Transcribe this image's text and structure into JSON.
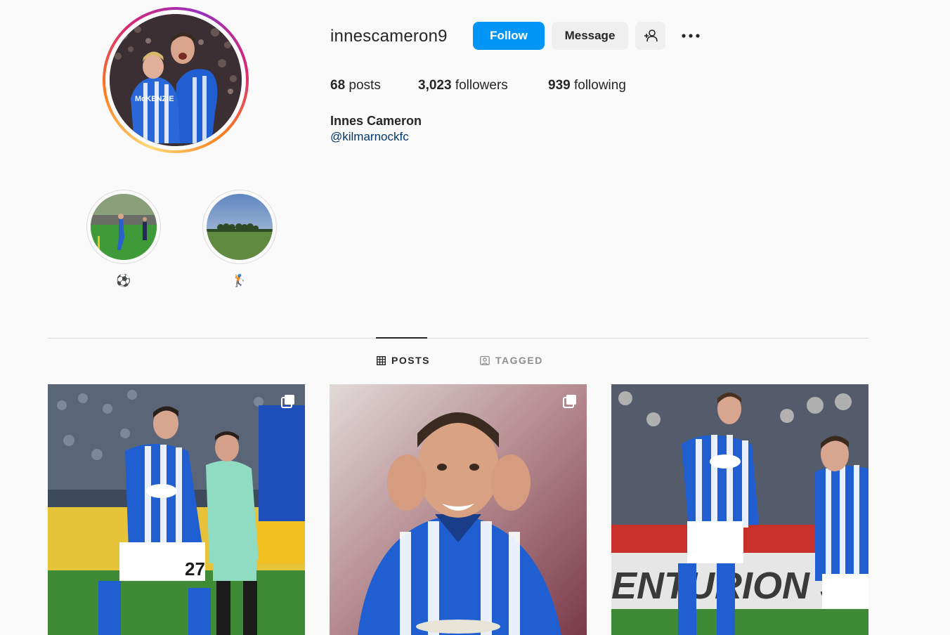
{
  "profile": {
    "username": "innescameron9",
    "full_name": "Innes Cameron",
    "bio_mention": "@kilmarnockfc",
    "avatar_icon": "profile-photo"
  },
  "actions": {
    "follow_label": "Follow",
    "message_label": "Message",
    "add_user_icon": "add-user-icon",
    "more_icon": "more-options-icon"
  },
  "stats": {
    "posts_count": "68",
    "posts_label": "posts",
    "followers_count": "3,023",
    "followers_label": "followers",
    "following_count": "939",
    "following_label": "following"
  },
  "highlights": [
    {
      "label": "⚽"
    },
    {
      "label": "🏌"
    }
  ],
  "tabs": {
    "posts_label": "POSTS",
    "tagged_label": "TAGGED",
    "active": "posts"
  },
  "posts": [
    {
      "multi": true
    },
    {
      "multi": true
    },
    {
      "multi": false
    }
  ],
  "colors": {
    "accent_blue": "#0095f6",
    "link_blue": "#00376b",
    "kit_blue": "#1f5fd1"
  }
}
